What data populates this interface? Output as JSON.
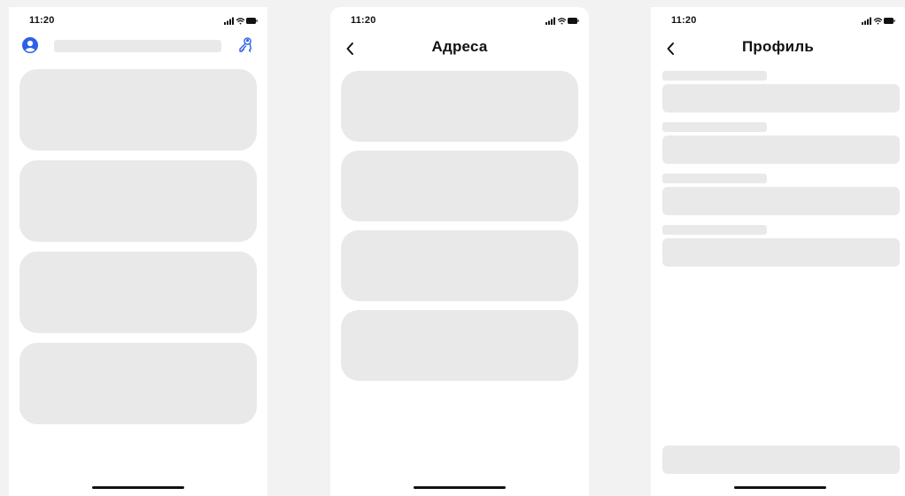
{
  "colors": {
    "background": "#f2f2f3",
    "screen": "#ffffff",
    "skeleton": "#e9e9ea",
    "accent": "#2f5fe8",
    "text": "#111111"
  },
  "screens": {
    "home": {
      "status_time": "11:20",
      "header": {
        "left_icon": "user-avatar-icon",
        "right_icon": "keys-icon",
        "search_placeholder_skeleton": true
      },
      "card_count": 4
    },
    "addresses": {
      "status_time": "11:20",
      "title": "Адреса",
      "back_icon": "chevron-left-icon",
      "card_count": 4
    },
    "profile": {
      "status_time": "11:20",
      "title": "Профиль",
      "back_icon": "chevron-left-icon",
      "field_count": 4,
      "footer_button_skeleton": true
    }
  }
}
